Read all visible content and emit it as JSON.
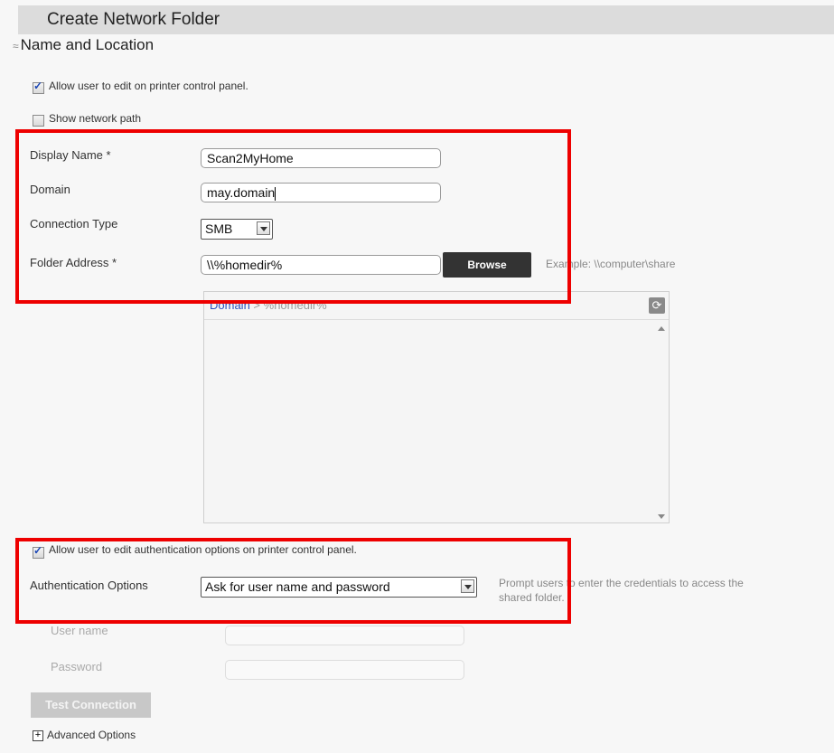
{
  "window": {
    "title": "Create Network Folder"
  },
  "section": {
    "chevron": "≈",
    "title": "Name and Location"
  },
  "options": {
    "allow_edit_panel": {
      "label": "Allow user to edit on printer control panel.",
      "checked": true
    },
    "show_network_path": {
      "label": "Show network path",
      "checked": false
    }
  },
  "form": {
    "display_name": {
      "label": "Display Name *",
      "value": "Scan2MyHome"
    },
    "domain": {
      "label": "Domain",
      "value": "may.domain"
    },
    "connection_type": {
      "label": "Connection Type",
      "value": "SMB"
    },
    "folder_address": {
      "label": "Folder Address *",
      "value": "\\\\%homedir%",
      "browse": "Browse",
      "hint": "Example: \\\\computer\\share"
    }
  },
  "tree": {
    "breadcrumb_root": "Domain",
    "breadcrumb_sep": ">",
    "breadcrumb_leaf": "%homedir%",
    "refresh_glyph": "⟳"
  },
  "auth": {
    "allow_edit_auth": {
      "label": "Allow user to edit authentication options on printer control panel.",
      "checked": true
    },
    "options_label": "Authentication Options",
    "options_value": "Ask for user name and password",
    "hint_line1": "Prompt users to enter the credentials to access the",
    "hint_line2": "shared folder.",
    "username_label": "User name",
    "password_label": "Password"
  },
  "buttons": {
    "test_connection": "Test Connection"
  },
  "advanced": {
    "glyph": "+",
    "label": "Advanced Options"
  },
  "colors": {
    "highlight_box": "#ee0000",
    "browse_button": "#333333",
    "checkbox_mark": "#1b46b5"
  }
}
